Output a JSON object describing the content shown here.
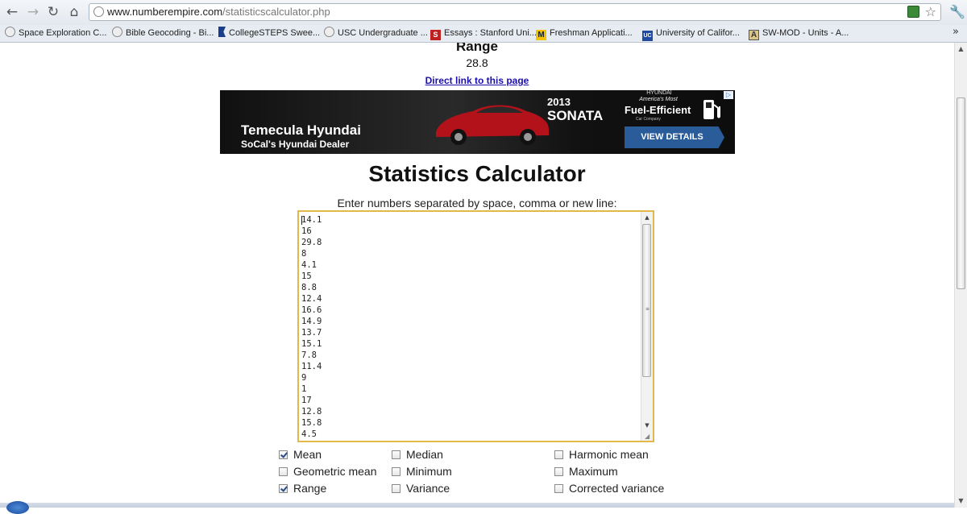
{
  "browser": {
    "url_host": "www.numberempire.com",
    "url_path": "/statisticscalculator.php",
    "bookmarks": [
      {
        "label": "Space Exploration C...",
        "icon": "globe-icon"
      },
      {
        "label": "Bible Geocoding - Bi...",
        "icon": "globe-icon"
      },
      {
        "label": "CollegeSTEPS Swee...",
        "icon": "flag-icon"
      },
      {
        "label": "USC Undergraduate ...",
        "icon": "globe-icon"
      },
      {
        "label": "Essays : Stanford Uni...",
        "icon": "s-logo-icon"
      },
      {
        "label": "Freshman Applicati...",
        "icon": "m-logo-icon"
      },
      {
        "label": "University of Califor...",
        "icon": "uc-logo-icon"
      },
      {
        "label": "SW-MOD - Units - A...",
        "icon": "a-logo-icon"
      }
    ],
    "bookmarks_overflow": "»"
  },
  "result": {
    "heading": "Range",
    "value": "28.8",
    "direct_link": "Direct link to this page"
  },
  "ad": {
    "dealer": "Temecula Hyundai",
    "sub": "SoCal's Hyundai Dealer",
    "year": "2013",
    "model": "SONATA",
    "brand": "HYUNDAI",
    "tagline_top": "America's Most",
    "tagline_main": "Fuel-Efficient",
    "tagline_bottom": "Car Company",
    "button": "VIEW DETAILS",
    "choices": "▷"
  },
  "calculator": {
    "title": "Statistics Calculator",
    "instructions": "Enter numbers separated by space, comma or new line:",
    "numbers": [
      "14.1",
      "16",
      "29.8",
      "8",
      "4.1",
      "15",
      "8.8",
      "12.4",
      "16.6",
      "14.9",
      "13.7",
      "15.1",
      "7.8",
      "11.4",
      "9",
      "1",
      "17",
      "12.8",
      "15.8",
      "4.5"
    ],
    "options": [
      {
        "label": "Mean",
        "checked": true
      },
      {
        "label": "Median",
        "checked": false
      },
      {
        "label": "Harmonic mean",
        "checked": false
      },
      {
        "label": "Geometric mean",
        "checked": false
      },
      {
        "label": "Minimum",
        "checked": false
      },
      {
        "label": "Maximum",
        "checked": false
      },
      {
        "label": "Range",
        "checked": true
      },
      {
        "label": "Variance",
        "checked": false
      },
      {
        "label": "Corrected variance",
        "checked": false
      }
    ]
  },
  "colors": {
    "link": "#1a0dab",
    "textarea_focus": "#e3b84a",
    "ad_button": "#2a5c9a"
  }
}
